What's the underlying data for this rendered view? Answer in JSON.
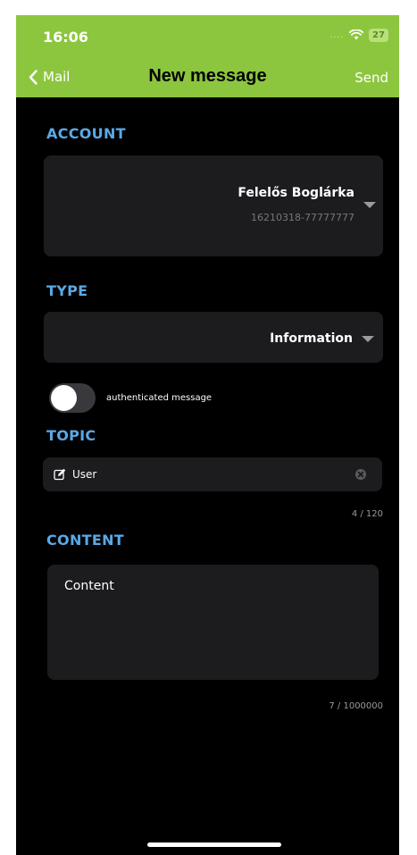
{
  "status_bar": {
    "time": "16:06",
    "signal": "....",
    "battery": "27"
  },
  "nav": {
    "back_label": "Mail",
    "title": "New message",
    "send_label": "Send"
  },
  "account": {
    "section_label": "ACCOUNT",
    "name": "Felelős Boglárka",
    "id": "16210318-77777777"
  },
  "type": {
    "section_label": "TYPE",
    "value": "Information"
  },
  "authenticated": {
    "label": "authenticated message",
    "enabled": false
  },
  "topic": {
    "section_label": "TOPIC",
    "value": "User",
    "counter": "4 / 120"
  },
  "content": {
    "section_label": "CONTENT",
    "value": "Content",
    "counter": "7 / 1000000"
  },
  "colors": {
    "header_bg": "#8cc63f",
    "section_label": "#5aa9e6",
    "background": "#000000",
    "panel": "#1c1c1e"
  }
}
